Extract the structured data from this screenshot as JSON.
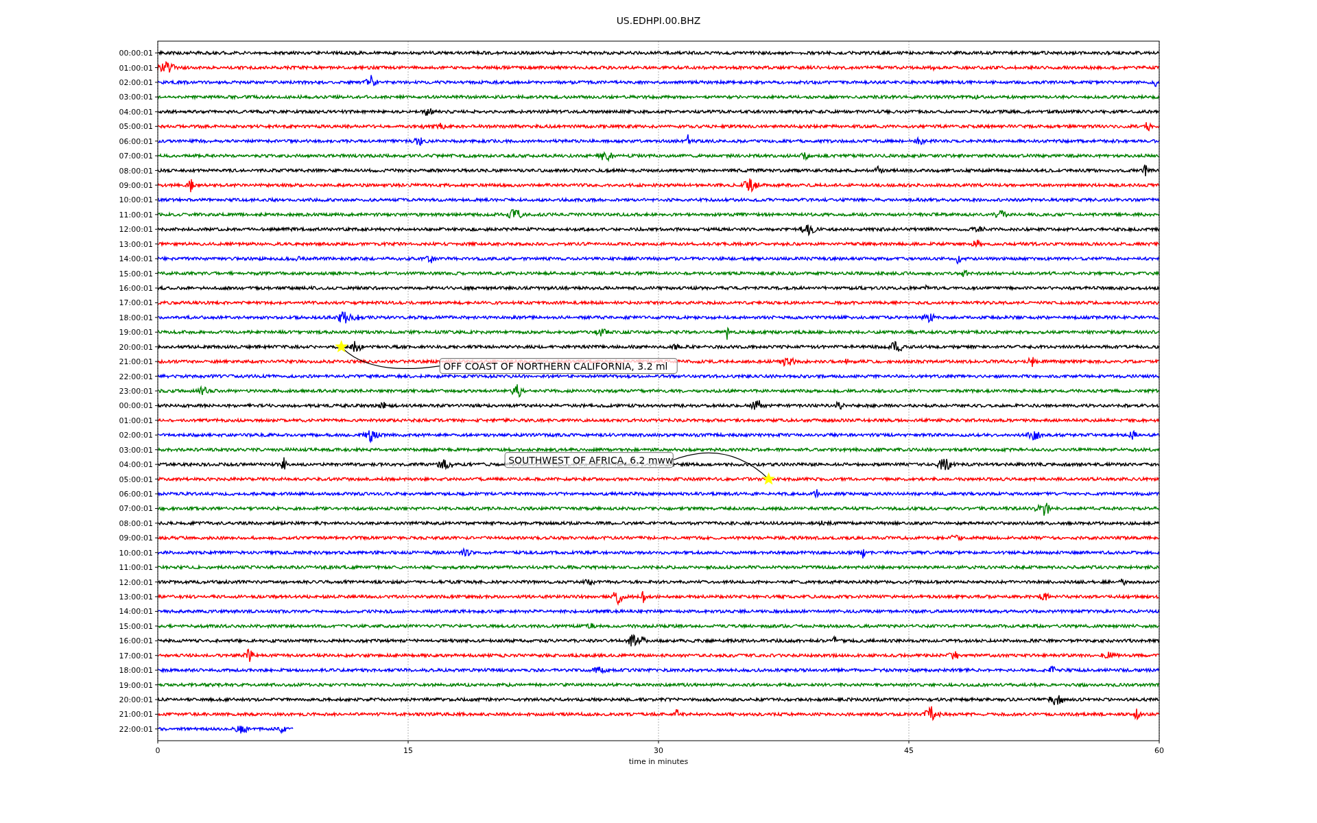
{
  "chart_data": {
    "type": "line",
    "orientation": "horizontal",
    "title": "US.EDHPI.00.BHZ",
    "xlabel": "time in minutes",
    "xlim": [
      0,
      60
    ],
    "xticks": [
      {
        "value": 0,
        "label": "0"
      },
      {
        "value": 15,
        "label": "15"
      },
      {
        "value": 30,
        "label": "30"
      },
      {
        "value": 45,
        "label": "45"
      },
      {
        "value": 60,
        "label": "60"
      }
    ],
    "categories": [
      "00:00:01",
      "01:00:01",
      "02:00:01",
      "03:00:01",
      "04:00:01",
      "05:00:01",
      "06:00:01",
      "07:00:01",
      "08:00:01",
      "09:00:01",
      "10:00:01",
      "11:00:01",
      "12:00:01",
      "13:00:01",
      "14:00:01",
      "15:00:01",
      "16:00:01",
      "17:00:01",
      "18:00:01",
      "19:00:01",
      "20:00:01",
      "21:00:01",
      "22:00:01",
      "23:00:01",
      "00:00:01",
      "01:00:01",
      "02:00:01",
      "03:00:01",
      "04:00:01",
      "05:00:01",
      "06:00:01",
      "07:00:01",
      "08:00:01",
      "09:00:01",
      "10:00:01",
      "11:00:01",
      "12:00:01",
      "13:00:01",
      "14:00:01",
      "15:00:01",
      "16:00:01",
      "17:00:01",
      "18:00:01",
      "19:00:01",
      "20:00:01",
      "21:00:01",
      "22:00:01"
    ],
    "annotations": [
      "OFF COAST OF NORTHERN CALIFORNIA, 3.2 ml",
      "SOUTHWEST OF AFRICA, 6.2 mww"
    ],
    "grid": true
  },
  "traces": [
    {
      "kind": "full",
      "color": "#000000"
    },
    {
      "kind": "full",
      "color": "#ff0000"
    },
    {
      "kind": "full",
      "color": "#0000ff"
    },
    {
      "kind": "full",
      "color": "#008000"
    },
    {
      "kind": "full",
      "color": "#000000"
    },
    {
      "kind": "full",
      "color": "#ff0000"
    },
    {
      "kind": "full",
      "color": "#0000ff"
    },
    {
      "kind": "full",
      "color": "#008000"
    },
    {
      "kind": "full",
      "color": "#000000"
    },
    {
      "kind": "full",
      "color": "#ff0000"
    },
    {
      "kind": "full",
      "color": "#0000ff"
    },
    {
      "kind": "full",
      "color": "#008000"
    },
    {
      "kind": "full",
      "color": "#000000"
    },
    {
      "kind": "full",
      "color": "#ff0000"
    },
    {
      "kind": "full",
      "color": "#0000ff"
    },
    {
      "kind": "full",
      "color": "#008000"
    },
    {
      "kind": "full",
      "color": "#000000"
    },
    {
      "kind": "full",
      "color": "#ff0000"
    },
    {
      "kind": "full",
      "color": "#0000ff"
    },
    {
      "kind": "full",
      "color": "#008000"
    },
    {
      "kind": "full",
      "color": "#000000"
    },
    {
      "kind": "full",
      "color": "#ff0000"
    },
    {
      "kind": "full",
      "color": "#0000ff"
    },
    {
      "kind": "full",
      "color": "#008000"
    },
    {
      "kind": "full",
      "color": "#000000"
    },
    {
      "kind": "full",
      "color": "#ff0000"
    },
    {
      "kind": "full",
      "color": "#0000ff"
    },
    {
      "kind": "full",
      "color": "#008000"
    },
    {
      "kind": "full",
      "color": "#000000"
    },
    {
      "kind": "full",
      "color": "#ff0000"
    },
    {
      "kind": "full",
      "color": "#0000ff"
    },
    {
      "kind": "full",
      "color": "#008000"
    },
    {
      "kind": "full",
      "color": "#000000"
    },
    {
      "kind": "full",
      "color": "#ff0000"
    },
    {
      "kind": "full",
      "color": "#0000ff"
    },
    {
      "kind": "full",
      "color": "#008000"
    },
    {
      "kind": "full",
      "color": "#000000"
    },
    {
      "kind": "full",
      "color": "#ff0000"
    },
    {
      "kind": "full",
      "color": "#0000ff"
    },
    {
      "kind": "full",
      "color": "#008000"
    },
    {
      "kind": "full",
      "color": "#000000"
    },
    {
      "kind": "full",
      "color": "#ff0000"
    },
    {
      "kind": "full",
      "color": "#0000ff"
    },
    {
      "kind": "full",
      "color": "#008000"
    },
    {
      "kind": "full",
      "color": "#000000"
    },
    {
      "kind": "full",
      "color": "#ff0000"
    },
    {
      "kind": "partial",
      "color": "#0000ff"
    }
  ]
}
